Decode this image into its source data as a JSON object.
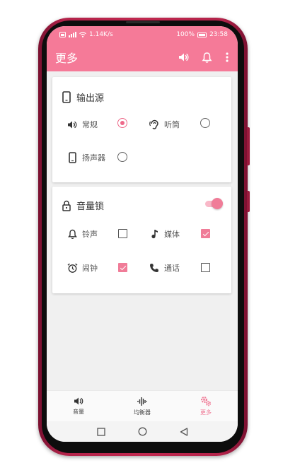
{
  "status_bar": {
    "network_speed": "1.14K/s",
    "battery": "100%",
    "time": "23:58"
  },
  "app_bar": {
    "title": "更多"
  },
  "output_card": {
    "title": "输出源",
    "options": [
      {
        "label": "常规",
        "selected": true
      },
      {
        "label": "听筒",
        "selected": false
      },
      {
        "label": "扬声器",
        "selected": false
      }
    ]
  },
  "volume_lock_card": {
    "title": "音量锁",
    "enabled": true,
    "items": [
      {
        "label": "铃声",
        "checked": false
      },
      {
        "label": "媒体",
        "checked": true
      },
      {
        "label": "闹钟",
        "checked": true
      },
      {
        "label": "通话",
        "checked": false
      }
    ]
  },
  "bottom_nav": {
    "items": [
      {
        "label": "音量",
        "active": false
      },
      {
        "label": "均衡器",
        "active": false
      },
      {
        "label": "更多",
        "active": true
      }
    ]
  },
  "colors": {
    "accent": "#f57a98",
    "phone_frame": "#c0284f"
  }
}
